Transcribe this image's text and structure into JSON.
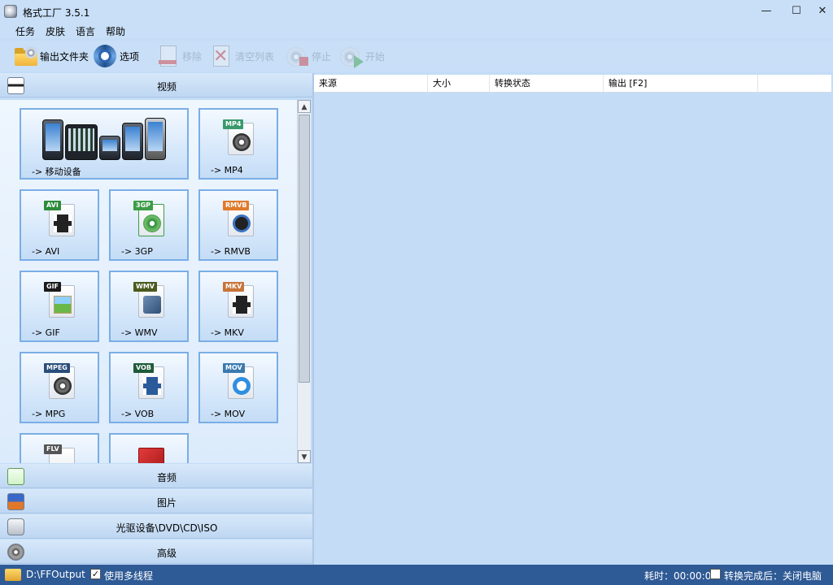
{
  "window": {
    "title": "格式工厂 3.5.1",
    "controls": {
      "minimize": "—",
      "maximize": "☐",
      "close": "✕"
    }
  },
  "menu": [
    "任务",
    "皮肤",
    "语言",
    "帮助"
  ],
  "toolbar": {
    "output_folder": "输出文件夹",
    "options": "选项",
    "remove": "移除",
    "clear_list": "清空列表",
    "stop": "停止",
    "start": "开始"
  },
  "categories": {
    "video": "视频",
    "audio": "音频",
    "picture": "图片",
    "disc": "光驱设备\\DVD\\CD\\ISO",
    "advanced": "高级"
  },
  "formats": [
    {
      "label": "-> 移动设备",
      "badge": "",
      "badge_color": ""
    },
    {
      "label": "-> MP4",
      "badge": "MP4",
      "badge_color": "#3a9a6e"
    },
    {
      "label": "-> AVI",
      "badge": "AVI",
      "badge_color": "#2e8b3a"
    },
    {
      "label": "-> 3GP",
      "badge": "3GP",
      "badge_color": "#3d9c48"
    },
    {
      "label": "-> RMVB",
      "badge": "RMVB",
      "badge_color": "#e07a2a"
    },
    {
      "label": "-> GIF",
      "badge": "GIF",
      "badge_color": "#1a1a1a"
    },
    {
      "label": "-> WMV",
      "badge": "WMV",
      "badge_color": "#4a5a1e"
    },
    {
      "label": "-> MKV",
      "badge": "MKV",
      "badge_color": "#c8743a"
    },
    {
      "label": "-> MPG",
      "badge": "MPEG",
      "badge_color": "#2a4d7a"
    },
    {
      "label": "-> VOB",
      "badge": "VOB",
      "badge_color": "#1e5a3a"
    },
    {
      "label": "-> MOV",
      "badge": "MOV",
      "badge_color": "#3a7ab0"
    },
    {
      "label": "",
      "badge": "FLV",
      "badge_color": "#555555"
    },
    {
      "label": "",
      "badge": "",
      "badge_color": "#cc2222"
    }
  ],
  "table": {
    "columns": [
      "来源",
      "大小",
      "转换状态",
      "输出 [F2]"
    ],
    "rows": []
  },
  "status": {
    "output_path": "D:\\FFOutput",
    "multithread_label": "使用多线程",
    "multithread_checked": "✓",
    "elapsed": "耗时：00:00:00",
    "after_done": "转换完成后：关闭电脑"
  }
}
